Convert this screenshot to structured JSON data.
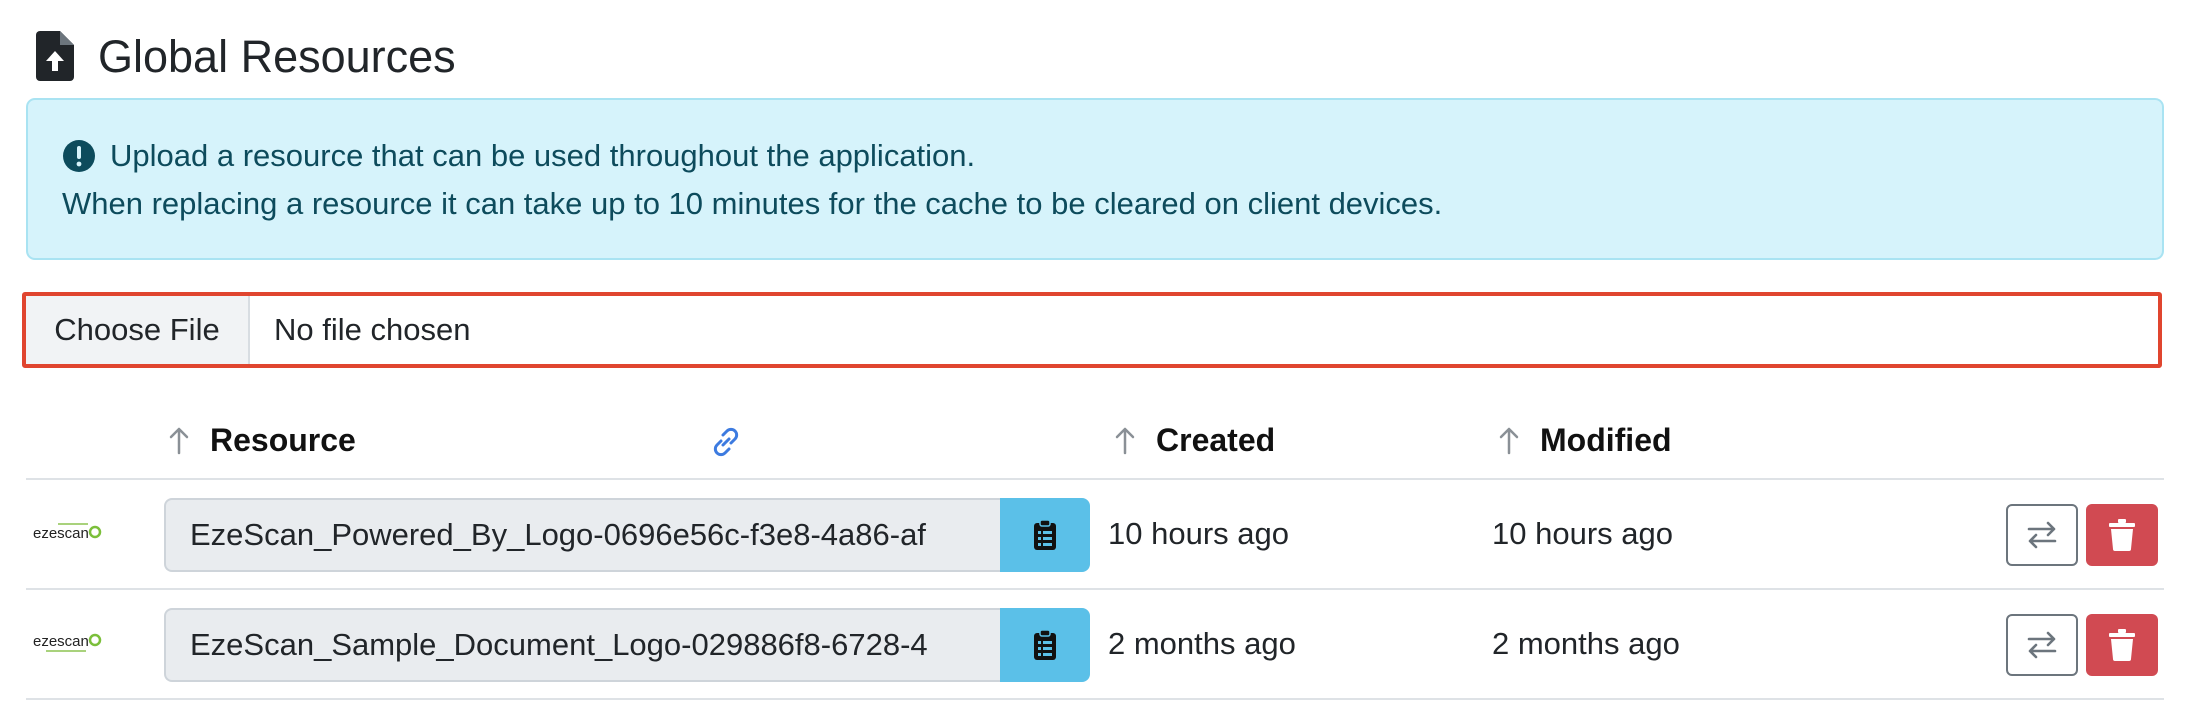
{
  "page": {
    "title": "Global Resources",
    "icon": "file-upload-icon"
  },
  "alert": {
    "icon": "exclamation-circle-icon",
    "line1": "Upload a resource that can be used throughout the application.",
    "line2": "When replacing a resource it can take up to 10 minutes for the cache to be cleared on client devices."
  },
  "file_input": {
    "button_label": "Choose File",
    "status": "No file chosen"
  },
  "table": {
    "columns": {
      "resource": "Resource",
      "link_icon": "link-icon",
      "created": "Created",
      "modified": "Modified",
      "sort_icon": "arrow-up-icon"
    },
    "rows": [
      {
        "thumbnail_icon": "ezescan-logo",
        "thumbnail_text": "ezescan",
        "name": "EzeScan_Powered_By_Logo-0696e56c-f3e8-4a86-af",
        "created": "10 hours ago",
        "modified": "10 hours ago"
      },
      {
        "thumbnail_icon": "ezescan-logo",
        "thumbnail_text": "ezescan",
        "name": "EzeScan_Sample_Document_Logo-029886f8-6728-4",
        "created": "2 months ago",
        "modified": "2 months ago"
      }
    ],
    "row_actions": {
      "copy_icon": "clipboard-icon",
      "replace_icon": "exchange-icon",
      "delete_icon": "trash-icon"
    }
  },
  "colors": {
    "alert_bg": "#d6f3fb",
    "alert_text": "#0d4b5c",
    "highlight_border": "#e0452f",
    "copy_button": "#5bc0e8",
    "delete_button": "#d14a52",
    "link_blue": "#3d7be0"
  }
}
